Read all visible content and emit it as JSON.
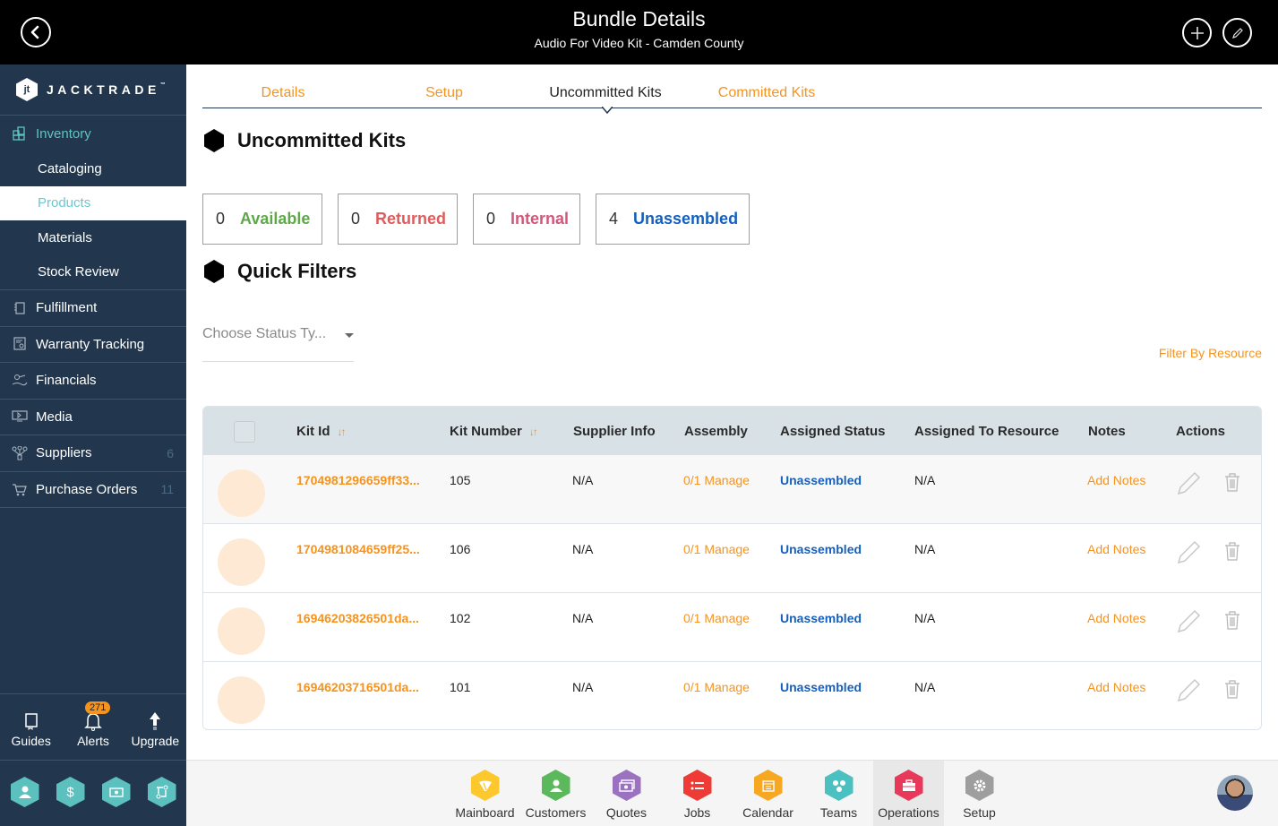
{
  "header": {
    "title": "Bundle Details",
    "subtitle": "Audio For Video Kit - Camden County",
    "back_icon": "chevron-left-circle-icon",
    "add_icon": "plus-circle-icon",
    "edit_icon": "pencil-circle-icon"
  },
  "sidebar": {
    "brand": "JACKTRADE",
    "brand_tm": "™",
    "inventory": {
      "label": "Inventory",
      "children": [
        {
          "label": "Cataloging"
        },
        {
          "label": "Products",
          "selected": true
        },
        {
          "label": "Materials"
        },
        {
          "label": "Stock Review"
        }
      ]
    },
    "items": [
      {
        "label": "Fulfillment",
        "icon": "fulfillment-icon",
        "count": ""
      },
      {
        "label": "Warranty Tracking",
        "icon": "warranty-icon",
        "count": ""
      },
      {
        "label": "Financials",
        "icon": "financials-icon",
        "count": ""
      },
      {
        "label": "Media",
        "icon": "media-icon",
        "count": ""
      },
      {
        "label": "Suppliers",
        "icon": "suppliers-icon",
        "count": "6"
      },
      {
        "label": "Purchase Orders",
        "icon": "purchase-orders-icon",
        "count": "11"
      }
    ],
    "utilities": [
      {
        "label": "Guides",
        "icon": "book-icon"
      },
      {
        "label": "Alerts",
        "icon": "bell-icon",
        "badge": "271"
      },
      {
        "label": "Upgrade",
        "icon": "arrow-up-icon"
      }
    ],
    "quick_apps": [
      {
        "icon": "user-hex-icon"
      },
      {
        "icon": "dollar-hex-icon"
      },
      {
        "icon": "money-hex-icon"
      },
      {
        "icon": "workflow-hex-icon"
      }
    ]
  },
  "tabs": [
    {
      "label": "Details",
      "active": false
    },
    {
      "label": "Setup",
      "active": false
    },
    {
      "label": "Uncommitted Kits",
      "active": true
    },
    {
      "label": "Committed Kits",
      "active": false
    }
  ],
  "page": {
    "section_title": "Uncommitted Kits",
    "quick_filters_title": "Quick Filters",
    "status_select_placeholder": "Choose Status Ty...",
    "filter_by_resource": "Filter By Resource"
  },
  "stats": [
    {
      "count": "0",
      "label": "Available",
      "color": "#5fa84a"
    },
    {
      "count": "0",
      "label": "Returned",
      "color": "#e05b5b"
    },
    {
      "count": "0",
      "label": "Internal",
      "color": "#d2577a"
    },
    {
      "count": "4",
      "label": "Unassembled",
      "color": "#1560bd"
    }
  ],
  "table": {
    "columns": [
      "Kit Id",
      "Kit Number",
      "Supplier Info",
      "Assembly",
      "Assigned Status",
      "Assigned To Resource",
      "Notes",
      "Actions"
    ],
    "rows": [
      {
        "kit_id": "1704981296659ff33...",
        "kit_number": "105",
        "supplier_info": "N/A",
        "assembly": "0/1 Manage",
        "assigned_status": "Unassembled",
        "assigned_resource": "N/A",
        "notes": "Add Notes"
      },
      {
        "kit_id": "1704981084659ff25...",
        "kit_number": "106",
        "supplier_info": "N/A",
        "assembly": "0/1 Manage",
        "assigned_status": "Unassembled",
        "assigned_resource": "N/A",
        "notes": "Add Notes"
      },
      {
        "kit_id": "16946203826501da...",
        "kit_number": "102",
        "supplier_info": "N/A",
        "assembly": "0/1 Manage",
        "assigned_status": "Unassembled",
        "assigned_resource": "N/A",
        "notes": "Add Notes"
      },
      {
        "kit_id": "16946203716501da...",
        "kit_number": "101",
        "supplier_info": "N/A",
        "assembly": "0/1 Manage",
        "assigned_status": "Unassembled",
        "assigned_resource": "N/A",
        "notes": "Add Notes"
      }
    ]
  },
  "dock": [
    {
      "label": "Mainboard",
      "color": "#fcc82d",
      "icon": "mainboard-icon"
    },
    {
      "label": "Customers",
      "color": "#5cb85c",
      "icon": "customers-icon"
    },
    {
      "label": "Quotes",
      "color": "#9b72c0",
      "icon": "quotes-icon"
    },
    {
      "label": "Jobs",
      "color": "#ef3b36",
      "icon": "jobs-icon"
    },
    {
      "label": "Calendar",
      "color": "#f7a823",
      "icon": "calendar-icon"
    },
    {
      "label": "Teams",
      "color": "#4bc0c0",
      "icon": "teams-icon"
    },
    {
      "label": "Operations",
      "color": "#e8395a",
      "icon": "operations-icon",
      "active": true
    },
    {
      "label": "Setup",
      "color": "#9e9e9e",
      "icon": "setup-gear-icon"
    }
  ],
  "colors": {
    "accent": "#f6931d",
    "sidebar_bg": "#22374d",
    "teal": "#5fc4c1",
    "link_blue": "#1560bd"
  }
}
